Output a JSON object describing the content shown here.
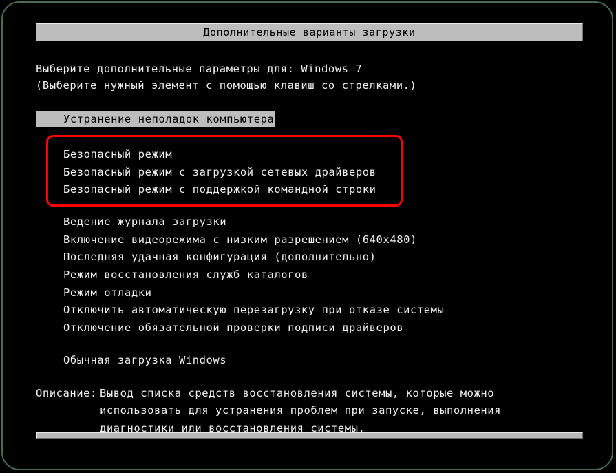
{
  "window": {
    "title": "Дополнительные варианты загрузки"
  },
  "intro": {
    "line1": "Выберите дополнительные параметры для: Windows 7",
    "line2": "(Выберите нужный элемент с помощью клавиш со стрелками.)"
  },
  "selected_item": {
    "label": "Устранение неполадок компьютера",
    "highlight_color": "#bdbdbd",
    "text_color": "#000000"
  },
  "annotation": {
    "type": "rounded-rectangle-highlight",
    "color": "#ff0000",
    "targets": [
      "Безопасный режим",
      "Безопасный режим с загрузкой сетевых драйверов",
      "Безопасный режим с поддержкой командной строки"
    ]
  },
  "options": {
    "safe_mode": "Безопасный режим",
    "safe_mode_network": "Безопасный режим с загрузкой сетевых драйверов",
    "safe_mode_cmd": "Безопасный режим с поддержкой командной строки",
    "boot_logging": "Ведение журнала загрузки",
    "low_resolution_video": "Включение видеорежима с низким разрешением (640x480)",
    "last_known_good": "Последняя удачная конфигурация (дополнительно)",
    "directory_services_restore": "Режим восстановления служб каталогов",
    "debugging_mode": "Режим отладки",
    "disable_auto_restart": "Отключить автоматическую перезагрузку при отказе системы",
    "disable_driver_signature": "Отключение обязательной проверки подписи драйверов",
    "start_windows_normally": "Обычная загрузка Windows"
  },
  "description": {
    "label": "Описание:",
    "line1": "Вывод списка средств восстановления системы, которые можно",
    "line2": "использовать для устранения проблем при запуске, выполнения",
    "line3": "диагностики или восстановления системы."
  },
  "colors": {
    "background": "#000000",
    "text": "#f0f0f0",
    "frame": "#4a6b4e",
    "bar": "#bdbdbd",
    "annotation": "#ff0000"
  }
}
